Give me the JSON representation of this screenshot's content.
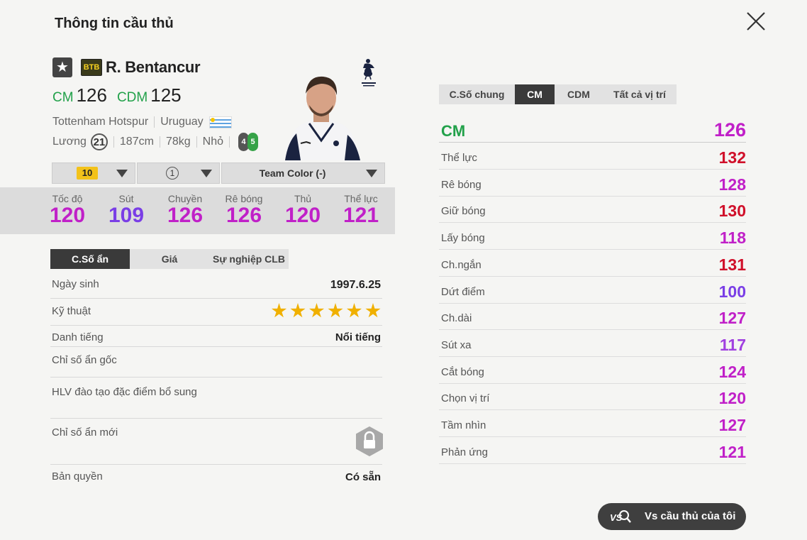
{
  "window": {
    "title": "Thông tin cầu thủ"
  },
  "player": {
    "season_badge": "BTB",
    "name": "R. Bentancur",
    "positions": [
      {
        "pos": "CM",
        "ovr": "126"
      },
      {
        "pos": "CDM",
        "ovr": "125"
      }
    ],
    "club": "Tottenham Hotspur",
    "nation": "Uruguay",
    "wage_label": "Lương",
    "wage": "21",
    "height": "187cm",
    "weight": "78kg",
    "body": "Nhỏ",
    "weak_foot": "4",
    "strong_foot": "5"
  },
  "selectors": {
    "level": "10",
    "team_color_count": "1",
    "team_color": "Team Color (-)"
  },
  "summary_stats": [
    {
      "label": "Tốc độ",
      "value": "120",
      "color": "#c020c8"
    },
    {
      "label": "Sút",
      "value": "109",
      "color": "#7a3ee6"
    },
    {
      "label": "Chuyền",
      "value": "126",
      "color": "#c020c8"
    },
    {
      "label": "Rê bóng",
      "value": "126",
      "color": "#c020c8"
    },
    {
      "label": "Thủ",
      "value": "120",
      "color": "#c020c8"
    },
    {
      "label": "Thể lực",
      "value": "121",
      "color": "#c020c8"
    }
  ],
  "left_tabs": [
    "C.Số ẩn",
    "Giá",
    "Sự nghiệp CLB"
  ],
  "info": {
    "birth_label": "Ngày sinh",
    "birth": "1997.6.25",
    "skill_label": "Kỹ thuật",
    "skill_stars": 6,
    "fame_label": "Danh tiếng",
    "fame": "Nổi tiếng",
    "hidden_label": "Chỉ số ẩn gốc",
    "coach_label": "HLV đào tạo đặc điểm bổ sung",
    "new_hidden_label": "Chỉ số ẩn mới",
    "copyright_label": "Bản quyền",
    "copyright": "Có sẵn"
  },
  "right_tabs": [
    "C.Số chung",
    "CM",
    "CDM",
    "Tất cả vị trí"
  ],
  "position_header": {
    "name": "CM",
    "value": "126",
    "color": "#22a14a",
    "value_color": "#c020c8"
  },
  "detail_stats": [
    {
      "name": "Thể lực",
      "value": "132",
      "color": "#d0102a"
    },
    {
      "name": "Rê bóng",
      "value": "128",
      "color": "#c020c8"
    },
    {
      "name": "Giữ bóng",
      "value": "130",
      "color": "#d0102a"
    },
    {
      "name": "Lấy bóng",
      "value": "118",
      "color": "#c020c8"
    },
    {
      "name": "Ch.ngắn",
      "value": "131",
      "color": "#d0102a"
    },
    {
      "name": "Dứt điểm",
      "value": "100",
      "color": "#7a3ee6"
    },
    {
      "name": "Ch.dài",
      "value": "127",
      "color": "#c020c8"
    },
    {
      "name": "Sút xa",
      "value": "117",
      "color": "#a040e0"
    },
    {
      "name": "Cắt bóng",
      "value": "124",
      "color": "#c020c8"
    },
    {
      "name": "Chọn vị trí",
      "value": "120",
      "color": "#c020c8"
    },
    {
      "name": "Tầm nhìn",
      "value": "127",
      "color": "#c020c8"
    },
    {
      "name": "Phản ứng",
      "value": "121",
      "color": "#c020c8"
    }
  ],
  "compare_button": {
    "label": "Vs cầu thủ của tôi",
    "icon_text": "VS"
  }
}
